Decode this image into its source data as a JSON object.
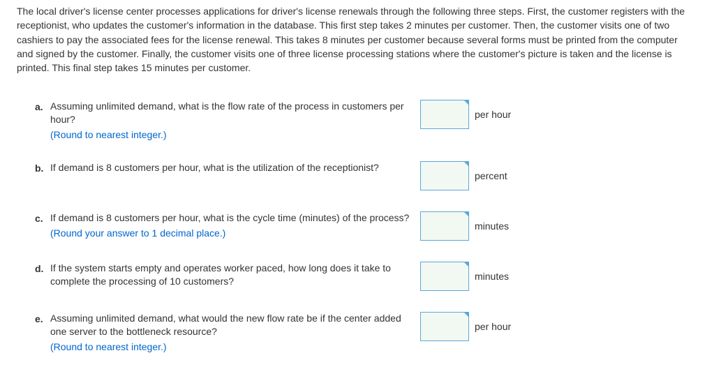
{
  "prompt_text": "The local driver's license center processes applications for driver's license renewals through the following three steps. First, the customer registers with the receptionist, who updates the customer's information in the database. This first step takes 2 minutes per customer. Then, the customer visits one of two cashiers to pay the associated fees for the license renewal. This takes 8 minutes per customer because several forms must be printed from the computer and signed by the customer. Finally, the customer visits one of three license processing stations where the customer's picture is taken and the license is printed. This final step takes 15 minutes per customer.",
  "questions": {
    "a": {
      "label": "a.",
      "text": "Assuming unlimited demand, what is the flow rate of the process in customers per hour?",
      "note": "(Round to nearest integer.)",
      "unit": "per hour"
    },
    "b": {
      "label": "b.",
      "text": "If demand is 8 customers per hour, what is the utilization of the receptionist?",
      "note": "",
      "unit": "percent"
    },
    "c": {
      "label": "c.",
      "text": "If demand is 8 customers per hour, what is the cycle time (minutes) of the process?",
      "note": "(Round your answer to 1 decimal place.)",
      "unit": "minutes"
    },
    "d": {
      "label": "d.",
      "text": "If the system starts empty and operates worker paced, how long does it take to complete the processing of 10 customers?",
      "note": "",
      "unit": "minutes"
    },
    "e": {
      "label": "e.",
      "text": "Assuming unlimited demand, what would the new flow rate be if the center added one server to the bottleneck resource?",
      "note": "(Round to nearest integer.)",
      "unit": "per hour"
    }
  }
}
